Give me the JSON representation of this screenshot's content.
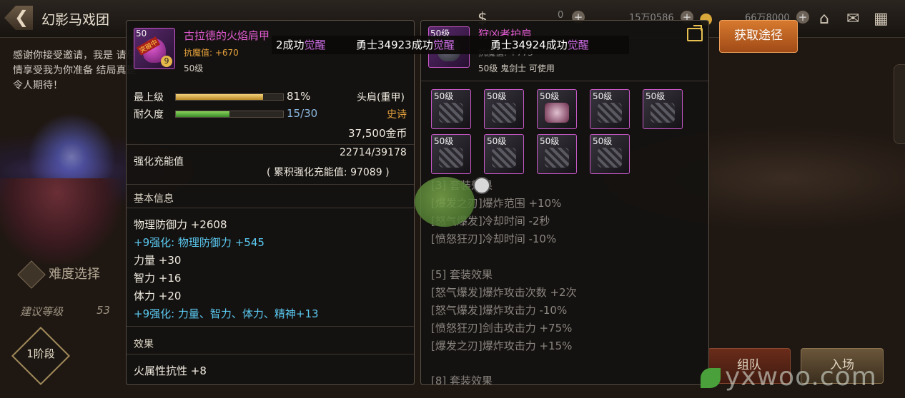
{
  "header": {
    "title": "幻影马戏团",
    "back_label": "❮",
    "resources": [
      {
        "value": "0",
        "icon": "gold-coin-icon"
      },
      {
        "value": "15万0586",
        "icon": "ticket-icon"
      },
      {
        "value": "66万8000",
        "icon": "coin-icon"
      }
    ]
  },
  "quest_text": "感谢你接受邀请，我是 请尽情享受我为你准备 结局真是令人期待！",
  "difficulty": {
    "label": "难度选择"
  },
  "recommend": {
    "label": "建议等级",
    "value": "53"
  },
  "stage": {
    "label": "1阶段"
  },
  "buttons": {
    "acquire": "获取途径",
    "team": "组队",
    "enter": "入场"
  },
  "banner": {
    "b1_prefix": "2成功",
    "b1_awaken": "觉醒",
    "b2_prefix": "勇士34923成功",
    "b2_awaken": "觉醒",
    "b3_prefix": "勇士34924成功",
    "b3_awaken": "觉醒"
  },
  "left_item": {
    "icon_level": "50",
    "icon_tag": "突破中",
    "icon_num": "9",
    "name": "古拉德的火焰肩甲",
    "magic_resist": "抗魔值: +670",
    "level": "50级",
    "quality_label": "最上级",
    "quality_pct": "81%",
    "quality_value": 81,
    "durability_label": "耐久度",
    "durability_text": "15/30",
    "durability_value": 0.5,
    "slot": "头肩(重甲)",
    "rarity": "史诗",
    "price": "37,500金币",
    "charge_label": "强化充能值",
    "charge_value": "22714/39178",
    "charge_total": "( 累积强化充能值: 97089 )",
    "basic_header": "基本信息",
    "stats": [
      {
        "text": "物理防御力 +2608",
        "blue": false
      },
      {
        "text": "+9强化: 物理防御力 +545",
        "blue": true
      },
      {
        "text": "力量 +30",
        "blue": false
      },
      {
        "text": "智力 +16",
        "blue": false
      },
      {
        "text": "体力 +20",
        "blue": false
      },
      {
        "text": "+9强化: 力量、智力、体力、精神+13",
        "blue": true
      }
    ],
    "effect_header": "效果",
    "effects": [
      "火属性抗性 +8"
    ]
  },
  "right_item": {
    "icon_level": "50级",
    "name": "狩凶者护肩",
    "magic_resist": "抗魔值: +773",
    "requirement": "50级 鬼剑士 可使用",
    "set_thumbs": [
      "50级",
      "50级",
      "50级",
      "50级",
      "50级",
      "50级",
      "50级",
      "50级",
      "50级"
    ],
    "set3_header": "[3] 套装效果",
    "set3": [
      "[爆发之刃]爆炸范围 +10%",
      "[怒气爆发]冷却时间 -2秒",
      "[愤怒狂刃]冷却时间 -10%"
    ],
    "set5_header": "[5] 套装效果",
    "set5": [
      "[怒气爆发]爆炸攻击次数 +2次",
      "[怒气爆发]爆炸攻击力 -10%",
      "[愤怒狂刃]剑击攻击力 +75%",
      "[爆发之刃]爆炸攻击力 +15%"
    ],
    "set_more": "[8] 套装效果"
  },
  "watermark": "yxwoo.com",
  "colors": {
    "epic": "#e6a23c",
    "awaken": "#c86ae0",
    "enhance": "#5ac8f0",
    "item_name": "#e05ad0"
  }
}
